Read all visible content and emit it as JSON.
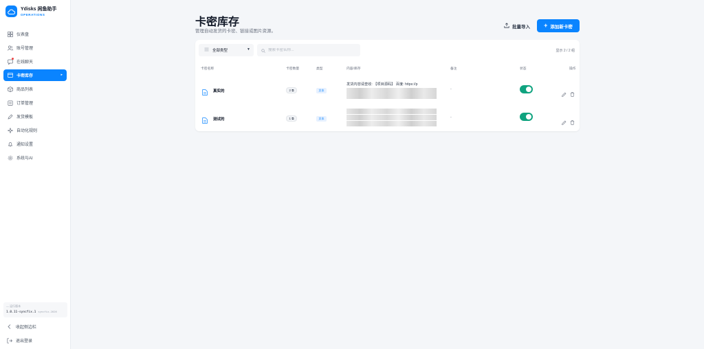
{
  "sidebar": {
    "brand_name": "Ydisks 闲鱼助手",
    "brand_sub": "OPERATIONS",
    "items": [
      {
        "label": "仪表盘",
        "icon": "dashboard-icon"
      },
      {
        "label": "账号管理",
        "icon": "users-icon"
      },
      {
        "label": "在线聊天",
        "icon": "chat-icon"
      },
      {
        "label": "卡密库存",
        "icon": "card-icon",
        "active": true
      },
      {
        "label": "商品列表",
        "icon": "box-icon"
      },
      {
        "label": "订单管理",
        "icon": "order-icon"
      },
      {
        "label": "发货模板",
        "icon": "template-icon"
      },
      {
        "label": "自动化规则",
        "icon": "automation-icon"
      },
      {
        "label": "通知设置",
        "icon": "bell-icon"
      },
      {
        "label": "系统与AI",
        "icon": "gear-icon"
      }
    ],
    "version_label": "运行版本",
    "version": "1.0.11-syncfix.1",
    "version_tag": "syncfix-2026",
    "collapse_label": "收起侧边栏",
    "logout_label": "退出登录"
  },
  "header": {
    "title": "卡密库存",
    "description": "管理自动发货的卡密、链接或图片资源。",
    "import_label": "批量导入",
    "add_label": "添加新卡密"
  },
  "toolbar": {
    "filter_value": "全部类型",
    "search_placeholder": "搜索卡密名称...",
    "count_text": "显示 2 / 2 组"
  },
  "table": {
    "columns": [
      "卡密名称",
      "卡密数量",
      "类型",
      "内容/库存",
      "备注",
      "状态",
      "操作"
    ],
    "rows": [
      {
        "name": "真实的",
        "stock": "2",
        "type": "文本",
        "content": "发货内容请查收: 【项目源码】 百度: https://p",
        "remark": "-",
        "enabled": true
      },
      {
        "name": "测试的",
        "stock": "1",
        "type": "文本",
        "content": "",
        "remark": "-",
        "enabled": true
      }
    ]
  },
  "colors": {
    "accent": "#0a84ff",
    "toggle_on": "#10a37f",
    "notification_dot": "#ef4444"
  }
}
